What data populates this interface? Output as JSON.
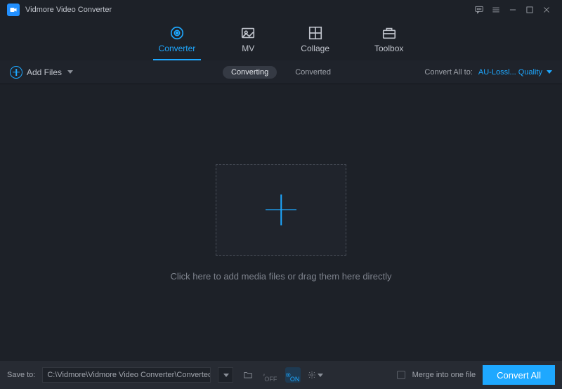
{
  "app": {
    "title": "Vidmore Video Converter"
  },
  "tabs": {
    "converter": "Converter",
    "mv": "MV",
    "collage": "Collage",
    "toolbox": "Toolbox"
  },
  "toolbar": {
    "add_files": "Add Files",
    "converting": "Converting",
    "converted": "Converted",
    "convert_all_to": "Convert All to:",
    "format": "AU-Lossl... Quality"
  },
  "main": {
    "drop_text": "Click here to add media files or drag them here directly"
  },
  "footer": {
    "save_to": "Save to:",
    "path": "C:\\Vidmore\\Vidmore Video Converter\\Converted",
    "off": "OFF",
    "on": "ON",
    "merge": "Merge into one file",
    "convert_all": "Convert All"
  }
}
